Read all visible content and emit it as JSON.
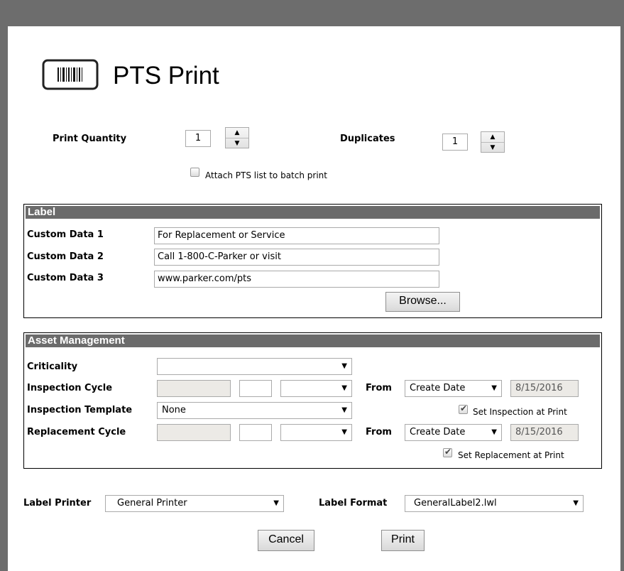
{
  "app": {
    "title": "PTS Print",
    "icon": "barcode-icon"
  },
  "print_options": {
    "print_quantity_label": "Print Quantity",
    "print_quantity_value": "1",
    "duplicates_label": "Duplicates",
    "duplicates_value": "1",
    "attach_label": "Attach PTS list to batch print",
    "attach_checked": false
  },
  "label": {
    "header": "Label",
    "rows": [
      {
        "label": "Custom Data 1",
        "value": "For Replacement or Service"
      },
      {
        "label": "Custom Data 2",
        "value": "Call 1-800-C-Parker or visit"
      },
      {
        "label": "Custom Data 3",
        "value": "www.parker.com/pts"
      }
    ],
    "browse_label": "Browse..."
  },
  "asset": {
    "header": "Asset Management",
    "criticality_label": "Criticality",
    "criticality_value": "",
    "inspection_cycle_label": "Inspection Cycle",
    "inspection_from_label": "From",
    "inspection_from_value": "Create Date",
    "inspection_date": "8/15/2016",
    "inspection_template_label": "Inspection Template",
    "inspection_template_value": "None",
    "set_inspection_label": "Set Inspection at Print",
    "set_inspection_checked": true,
    "replacement_cycle_label": "Replacement Cycle",
    "replacement_from_label": "From",
    "replacement_from_value": "Create Date",
    "replacement_date": "8/15/2016",
    "set_replacement_label": "Set Replacement at Print",
    "set_replacement_checked": true
  },
  "footer": {
    "label_printer_label": "Label Printer",
    "label_printer_value": "General Printer",
    "label_format_label": "Label Format",
    "label_format_value": "GeneralLabel2.lwl",
    "cancel_label": "Cancel",
    "print_label": "Print"
  }
}
